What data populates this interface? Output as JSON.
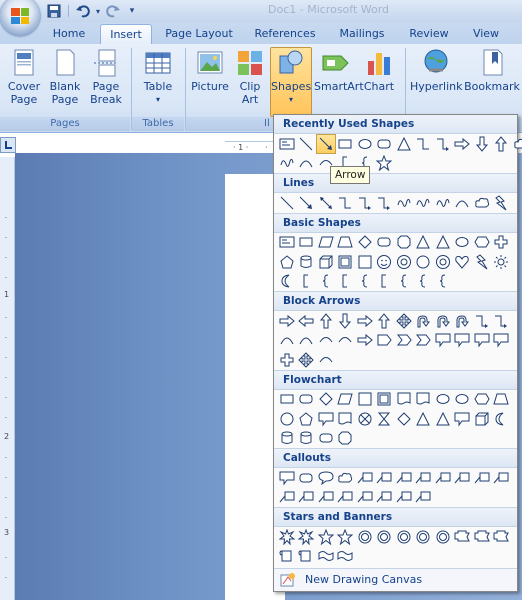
{
  "titlebar": {
    "title": "Doc1 - Microsoft Word"
  },
  "qat": {
    "save": "save-icon",
    "undo": "undo-icon",
    "redo": "redo-icon"
  },
  "tabs": [
    {
      "label": "Home"
    },
    {
      "label": "Insert",
      "active": true
    },
    {
      "label": "Page Layout"
    },
    {
      "label": "References"
    },
    {
      "label": "Mailings"
    },
    {
      "label": "Review"
    },
    {
      "label": "View"
    }
  ],
  "ribbon": {
    "cover_page": "Cover Page",
    "blank_page": "Blank Page",
    "page_break": "Page Break",
    "group_pages": "Pages",
    "table": "Table",
    "group_tables": "Tables",
    "picture": "Picture",
    "clip_art": "Clip Art",
    "shapes": "Shapes",
    "smartart": "SmartArt",
    "chart": "Chart",
    "group_illus": "Il",
    "hyperlink": "Hyperlink",
    "bookmark": "Bookmark",
    "group_links": "ks"
  },
  "shapes_menu": {
    "recently_used": "Recently Used Shapes",
    "lines": "Lines",
    "basic_shapes": "Basic Shapes",
    "block_arrows": "Block Arrows",
    "flowchart": "Flowchart",
    "callouts": "Callouts",
    "stars_banners": "Stars and Banners",
    "tooltip": "Arrow",
    "new_canvas": "New Drawing Canvas"
  },
  "colors": {
    "accent": "#15428b",
    "highlight": "#ffce5f",
    "ribbon_bg": "#dbe6f5",
    "workspace": "#7396c9"
  }
}
